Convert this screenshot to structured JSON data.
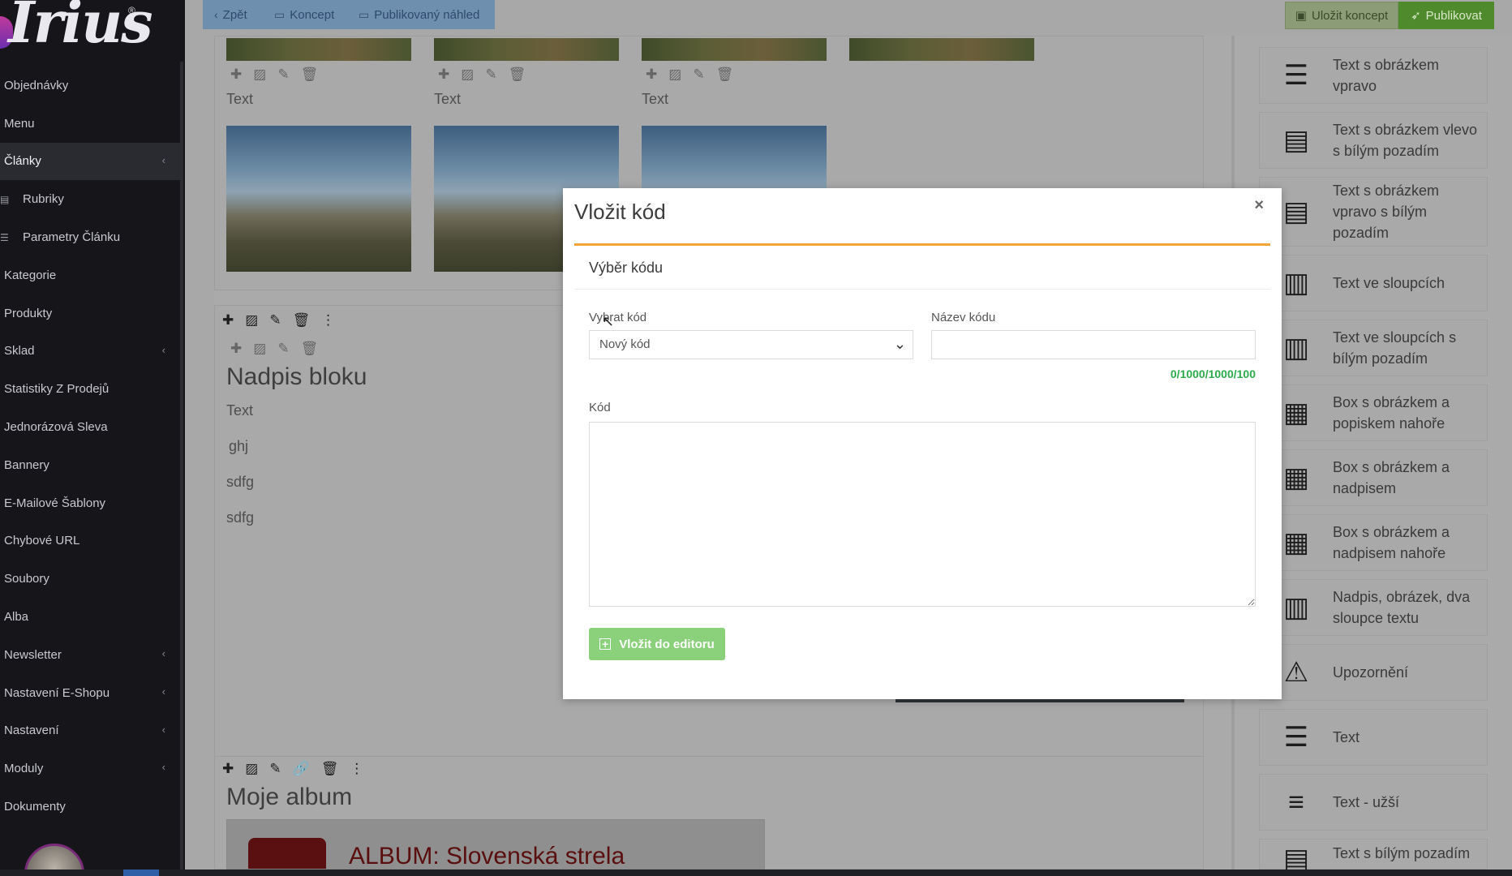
{
  "sidebar": {
    "logo_text": "Irius",
    "logo_reg": "®",
    "items": [
      {
        "label": "Objednávky"
      },
      {
        "label": "Menu"
      },
      {
        "label": "Články",
        "chevron": "‹"
      },
      {
        "label": "Rubriky"
      },
      {
        "label": "Parametry Článku"
      },
      {
        "label": "Kategorie"
      },
      {
        "label": "Produkty"
      },
      {
        "label": "Sklad",
        "chevron": "‹"
      },
      {
        "label": "Statistiky Z Prodejů"
      },
      {
        "label": "Jednorázová Sleva"
      },
      {
        "label": "Bannery"
      },
      {
        "label": "E-Mailové Šablony"
      },
      {
        "label": "Chybové URL"
      },
      {
        "label": "Soubory"
      },
      {
        "label": "Alba"
      },
      {
        "label": "Newsletter",
        "chevron": "‹"
      },
      {
        "label": "Nastavení E-Shopu",
        "chevron": "‹"
      },
      {
        "label": "Nastavení",
        "chevron": "‹"
      },
      {
        "label": "Moduly",
        "chevron": "‹"
      },
      {
        "label": "Dokumenty"
      }
    ]
  },
  "topbar": {
    "back": "Zpět",
    "draft": "Koncept",
    "preview": "Publikovaný náhled",
    "save_draft": "Uložit koncept",
    "publish": "Publikovat"
  },
  "canvas": {
    "text_label": "Text",
    "block_title": "Nadpis bloku",
    "lines": [
      "ghj",
      "sdfg",
      "sdfg"
    ],
    "album_title": "Moje album",
    "album_banner": "ALBUM: Slovenská strela"
  },
  "blocks": [
    {
      "icon": "text-image-right-icon",
      "label": "Text s obrázkem vpravo"
    },
    {
      "icon": "text-image-left-icon",
      "label": "Text s obrázkem vlevo s bílým pozadím"
    },
    {
      "icon": "text-image-right-white-icon",
      "label": "Text s obrázkem vpravo s bílým pozadím"
    },
    {
      "icon": "text-columns-icon",
      "label": "Text ve sloupcích"
    },
    {
      "icon": "text-columns-white-icon",
      "label": "Text ve sloupcích s bílým pozadím"
    },
    {
      "icon": "box-image-caption-top-icon",
      "label": "Box s obrázkem a popiskem nahoře"
    },
    {
      "icon": "box-image-heading-icon",
      "label": "Box s obrázkem a nadpisem"
    },
    {
      "icon": "box-image-heading-top-icon",
      "label": "Box s obrázkem a nadpisem nahoře"
    },
    {
      "icon": "heading-image-two-columns-icon",
      "label": "Nadpis, obrázek, dva sloupce textu"
    },
    {
      "icon": "warning-icon",
      "label": "Upozornění"
    },
    {
      "icon": "text-icon",
      "label": "Text"
    },
    {
      "icon": "text-narrow-icon",
      "label": "Text - užší"
    },
    {
      "icon": "text-white-bg-icon",
      "label": "Text s bílým pozadím"
    }
  ],
  "modal": {
    "title": "Vložit kód",
    "close": "×",
    "section_title": "Výběr kódu",
    "select_label": "Vybrat kód",
    "select_value": "Nový kód",
    "name_label": "Název kódu",
    "counter": "0/1000/1000/100",
    "code_label": "Kód",
    "insert_button": "Vložit do editoru"
  },
  "colors": {
    "accent_orange": "#f2a33a",
    "success_green": "#8bd07a",
    "counter_green": "#2dab4a",
    "publish_green": "#4f8a2c"
  }
}
